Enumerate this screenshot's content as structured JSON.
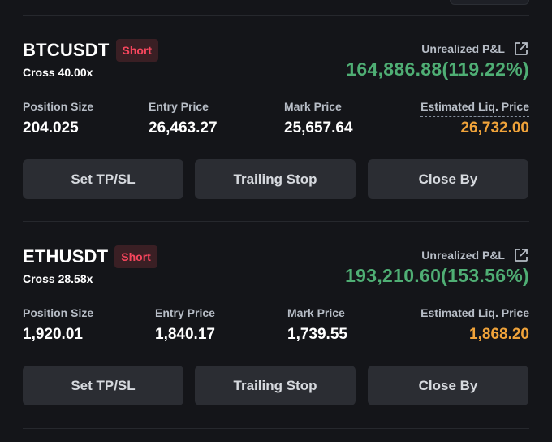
{
  "positions": [
    {
      "symbol": "BTCUSDT",
      "side": "Short",
      "margin": "Cross 40.00x",
      "upl_label": "Unrealized P&L",
      "upl_value": "164,886.88(119.22%)",
      "stats": {
        "position_size_label": "Position Size",
        "position_size": "204.025",
        "entry_price_label": "Entry Price",
        "entry_price": "26,463.27",
        "mark_price_label": "Mark Price",
        "mark_price": "25,657.64",
        "liq_price_label": "Estimated Liq. Price",
        "liq_price": "26,732.00"
      },
      "buttons": {
        "tpsl": "Set TP/SL",
        "trailing": "Trailing Stop",
        "close": "Close By"
      }
    },
    {
      "symbol": "ETHUSDT",
      "side": "Short",
      "margin": "Cross 28.58x",
      "upl_label": "Unrealized P&L",
      "upl_value": "193,210.60(153.56%)",
      "stats": {
        "position_size_label": "Position Size",
        "position_size": "1,920.01",
        "entry_price_label": "Entry Price",
        "entry_price": "1,840.17",
        "mark_price_label": "Mark Price",
        "mark_price": "1,739.55",
        "liq_price_label": "Estimated Liq. Price",
        "liq_price": "1,868.20"
      },
      "buttons": {
        "tpsl": "Set TP/SL",
        "trailing": "Trailing Stop",
        "close": "Close By"
      }
    }
  ],
  "colors": {
    "background": "#141519",
    "profit": "#4fae74",
    "short": "#f6465d",
    "liq": "#f0a33a",
    "button": "#2b2d33"
  },
  "icons": {
    "share": "external-link-icon"
  }
}
